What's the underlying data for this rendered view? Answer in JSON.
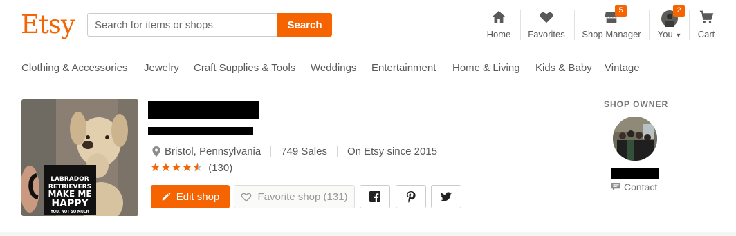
{
  "header": {
    "logo": "Etsy",
    "search_placeholder": "Search for items or shops",
    "search_button": "Search",
    "nav": {
      "home": "Home",
      "favorites": "Favorites",
      "shop_manager": "Shop Manager",
      "shop_manager_badge": "5",
      "you": "You",
      "you_badge": "2",
      "cart": "Cart"
    }
  },
  "categories": [
    "Clothing & Accessories",
    "Jewelry",
    "Craft Supplies & Tools",
    "Weddings",
    "Entertainment",
    "Home & Living",
    "Kids & Baby",
    "Vintage"
  ],
  "shop": {
    "location": "Bristol, Pennsylvania",
    "sales": "749 Sales",
    "since": "On Etsy since 2015",
    "rating": 4.5,
    "review_count": "(130)",
    "edit_button": "Edit shop",
    "favorite_button": "Favorite shop (131)",
    "mug_text": [
      "LABRADOR",
      "RETRIEVERS",
      "MAKE ME",
      "HAPPY",
      "YOU, NOT SO MUCH"
    ]
  },
  "owner": {
    "section_title": "SHOP OWNER",
    "contact_label": "Contact"
  },
  "colors": {
    "accent": "#f56400"
  }
}
